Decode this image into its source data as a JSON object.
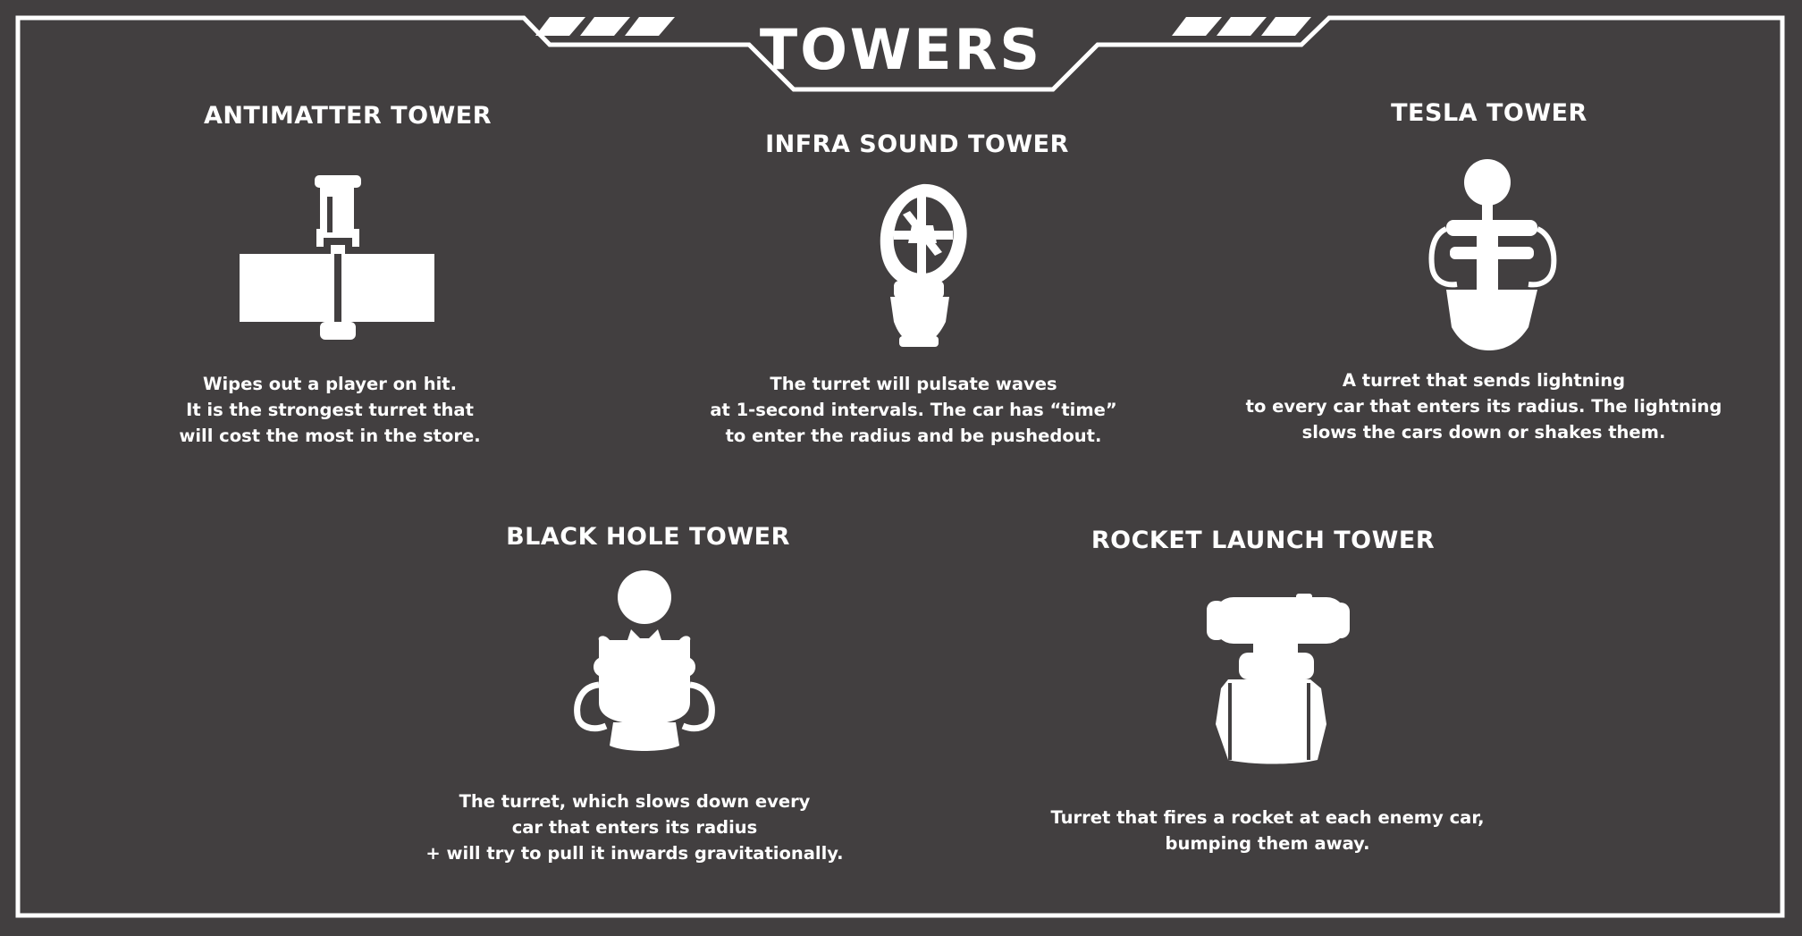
{
  "title": "TOWERS",
  "towers": [
    {
      "name": "ANTIMATTER TOWER",
      "icon": "antimatter-tower-icon",
      "description": [
        "Wipes out a player on hit.",
        "It is the strongest turret that",
        "will cost the most in the store."
      ]
    },
    {
      "name": "INFRA SOUND TOWER",
      "icon": "infra-sound-tower-icon",
      "description": [
        "The turret will pulsate waves",
        "at 1-second intervals. The car has “time”",
        "to enter the radius and be pushedout."
      ]
    },
    {
      "name": "TESLA TOWER",
      "icon": "tesla-tower-icon",
      "description": [
        "A turret that sends lightning",
        "to every car that enters its radius. The lightning",
        "slows the cars down or shakes them."
      ]
    },
    {
      "name": "BLACK HOLE TOWER",
      "icon": "black-hole-tower-icon",
      "description": [
        "The turret, which slows down every",
        "car that enters its radius",
        "+ will try to pull it inwards gravitationally."
      ]
    },
    {
      "name": "ROCKET LAUNCH TOWER",
      "icon": "rocket-launch-tower-icon",
      "description": [
        "Turret that fires a rocket at each enemy car,",
        "bumping them away."
      ]
    }
  ]
}
